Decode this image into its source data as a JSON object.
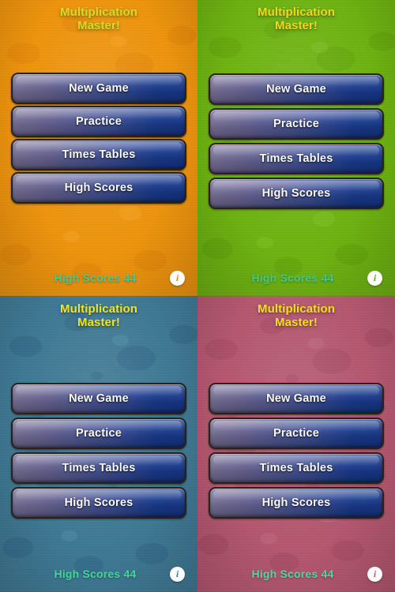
{
  "app": {
    "title_line1": "Multiplication",
    "title_line2": "Master!"
  },
  "menu": {
    "items": [
      {
        "label": "New Game"
      },
      {
        "label": "Practice"
      },
      {
        "label": "Times Tables"
      },
      {
        "label": "High Scores"
      }
    ]
  },
  "footer": {
    "high_scores_label": "High Scores 44",
    "info_icon": "info-icon",
    "info_glyph": "i"
  },
  "panels": [
    {
      "id": "orange",
      "name": "orange-theme-panel",
      "background": "#f2960c",
      "title_color": "#d4dc2a",
      "title_shadow": "#9a7c06",
      "high_scores_color": "#4ec98f",
      "info_glyph_color": "#e08a0d"
    },
    {
      "id": "green",
      "name": "green-theme-panel",
      "background": "#6fb610",
      "title_color": "#f0d821",
      "title_shadow": "#4a7a08",
      "high_scores_color": "#44c88c",
      "info_glyph_color": "#63a60c"
    },
    {
      "id": "blue",
      "name": "blue-theme-panel",
      "background": "#3f7a96",
      "title_color": "#f2e61c",
      "title_shadow": "#27566e",
      "high_scores_color": "#3fd79a",
      "info_glyph_color": "#3f7a96"
    },
    {
      "id": "pink",
      "name": "pink-theme-panel",
      "background": "#b75871",
      "title_color": "#f2e01c",
      "title_shadow": "#8a3a50",
      "high_scores_color": "#4ed9a0",
      "info_glyph_color": "#b75871"
    }
  ],
  "button_style": {
    "text_color": "#ffffff",
    "gradient_left": "#7a7398",
    "gradient_right": "#17378a",
    "border_color": "#2b2118"
  }
}
